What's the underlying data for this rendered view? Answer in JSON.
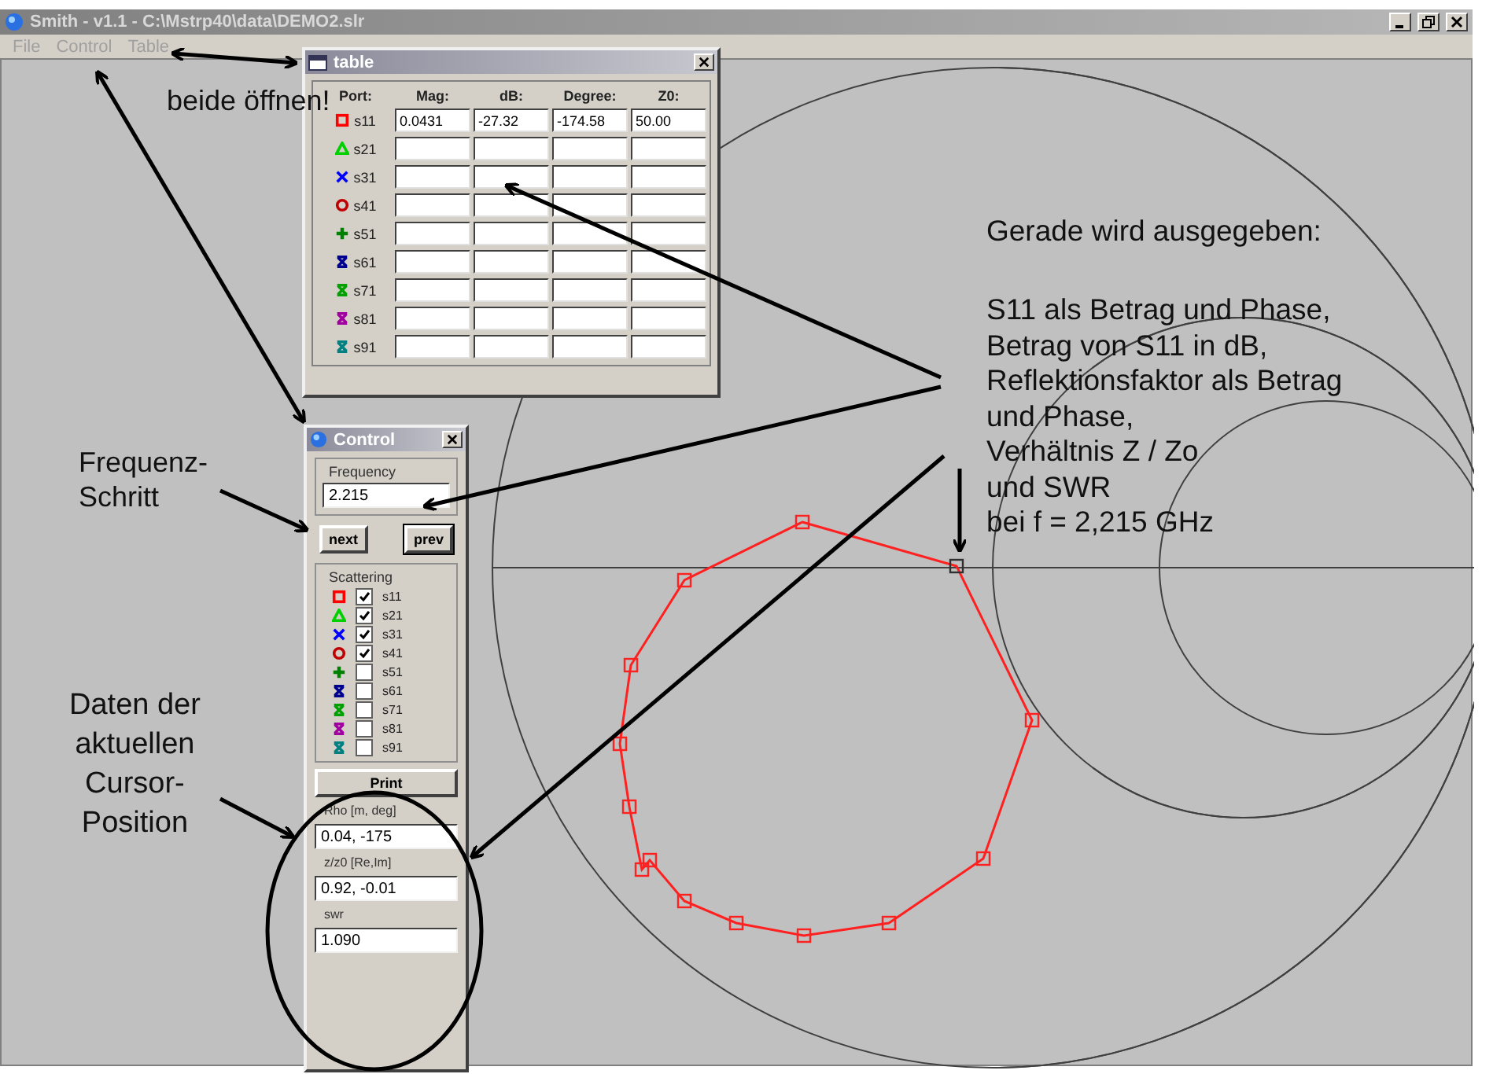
{
  "window": {
    "title": "Smith - v1.1 - C:\\Mstrp40\\data\\DEMO2.slr"
  },
  "menu": [
    "File",
    "Control",
    "Table"
  ],
  "table_window": {
    "title": "table",
    "columns": [
      "Port:",
      "Mag:",
      "dB:",
      "Degree:",
      "Z0:"
    ],
    "rows": [
      {
        "port": "s11",
        "kind": "square",
        "color": "#ff0000",
        "values": [
          "0.0431",
          "-27.32",
          "-174.58",
          "50.00"
        ]
      },
      {
        "port": "s21",
        "kind": "triangle",
        "color": "#00d000",
        "values": []
      },
      {
        "port": "s31",
        "kind": "x",
        "color": "#0000ff",
        "values": []
      },
      {
        "port": "s41",
        "kind": "circle",
        "color": "#c00000",
        "values": []
      },
      {
        "port": "s51",
        "kind": "plus",
        "color": "#008000",
        "values": []
      },
      {
        "port": "s61",
        "kind": "hourglass",
        "color": "#000090",
        "values": []
      },
      {
        "port": "s71",
        "kind": "hourglass",
        "color": "#00a000",
        "values": []
      },
      {
        "port": "s81",
        "kind": "hourglass",
        "color": "#a000a0",
        "values": []
      },
      {
        "port": "s91",
        "kind": "hourglass",
        "color": "#008080",
        "values": []
      }
    ]
  },
  "control_window": {
    "title": "Control",
    "frequency": {
      "label": "Frequency",
      "value": "2.215"
    },
    "buttons": [
      "next",
      "prev"
    ],
    "scattering": {
      "label": "Scattering",
      "items": [
        {
          "label": "s11",
          "kind": "square",
          "color": "#ff0000",
          "checked": true
        },
        {
          "label": "s21",
          "kind": "triangle",
          "color": "#00d000",
          "checked": true
        },
        {
          "label": "s31",
          "kind": "x",
          "color": "#0000ff",
          "checked": true
        },
        {
          "label": "s41",
          "kind": "circle",
          "color": "#c00000",
          "checked": true
        },
        {
          "label": "s51",
          "kind": "plus",
          "color": "#008000",
          "checked": false
        },
        {
          "label": "s61",
          "kind": "hourglass",
          "color": "#000090",
          "checked": false
        },
        {
          "label": "s71",
          "kind": "hourglass",
          "color": "#00a000",
          "checked": false
        },
        {
          "label": "s81",
          "kind": "hourglass",
          "color": "#a000a0",
          "checked": false
        },
        {
          "label": "s91",
          "kind": "hourglass",
          "color": "#008080",
          "checked": false
        }
      ]
    },
    "print_button": "Print",
    "readouts": [
      {
        "label": "Rho [m, deg]",
        "value": "0.04, -175"
      },
      {
        "label": "z/z0 [Re,Im]",
        "value": "0.92, -0.01"
      },
      {
        "label": "swr",
        "value": "1.090"
      }
    ]
  },
  "annotations": {
    "menus_note": "beide öffnen!",
    "step_note": "Frequenz-\nSchritt",
    "cursor_note": "Daten der\naktuellen\nCursor-\nPosition",
    "output_heading": "Gerade wird ausgegeben:",
    "output_note": [
      "S11 als Betrag und Phase,",
      "Betrag von S11 in dB,",
      "Reflektionsfaktor als Betrag",
      "und Phase,",
      "Verhältnis Z / Zo",
      "und SWR",
      "bei f = 2,215 GHz"
    ]
  }
}
